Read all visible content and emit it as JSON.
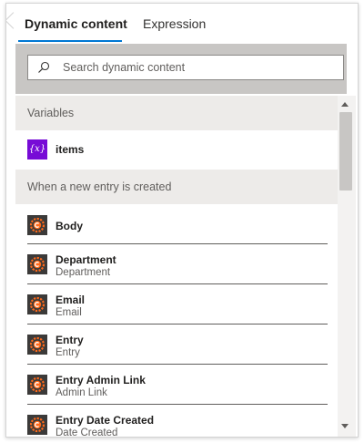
{
  "tabs": [
    {
      "label": "Dynamic content",
      "active": true
    },
    {
      "label": "Expression",
      "active": false
    }
  ],
  "search": {
    "placeholder": "Search dynamic content",
    "value": ""
  },
  "sections": [
    {
      "header": "Variables",
      "items": [
        {
          "title": "items",
          "icon": "variable-icon"
        }
      ]
    },
    {
      "header": "When a new entry is created",
      "items": [
        {
          "title": "Body",
          "subtitle": "",
          "icon": "trigger-app-icon"
        },
        {
          "title": "Department",
          "subtitle": "Department",
          "icon": "trigger-app-icon"
        },
        {
          "title": "Email",
          "subtitle": "Email",
          "icon": "trigger-app-icon"
        },
        {
          "title": "Entry",
          "subtitle": "Entry",
          "icon": "trigger-app-icon"
        },
        {
          "title": "Entry Admin Link",
          "subtitle": "Admin Link",
          "icon": "trigger-app-icon"
        },
        {
          "title": "Entry Date Created",
          "subtitle": "Date Created",
          "icon": "trigger-app-icon"
        }
      ]
    }
  ],
  "variable_icon_text": "{x}",
  "colors": {
    "accent": "#0078d4",
    "variable_icon_bg": "#770bd6",
    "trigger_icon_bg": "#3b3a39",
    "trigger_icon_gear": "#ff6a1a"
  }
}
